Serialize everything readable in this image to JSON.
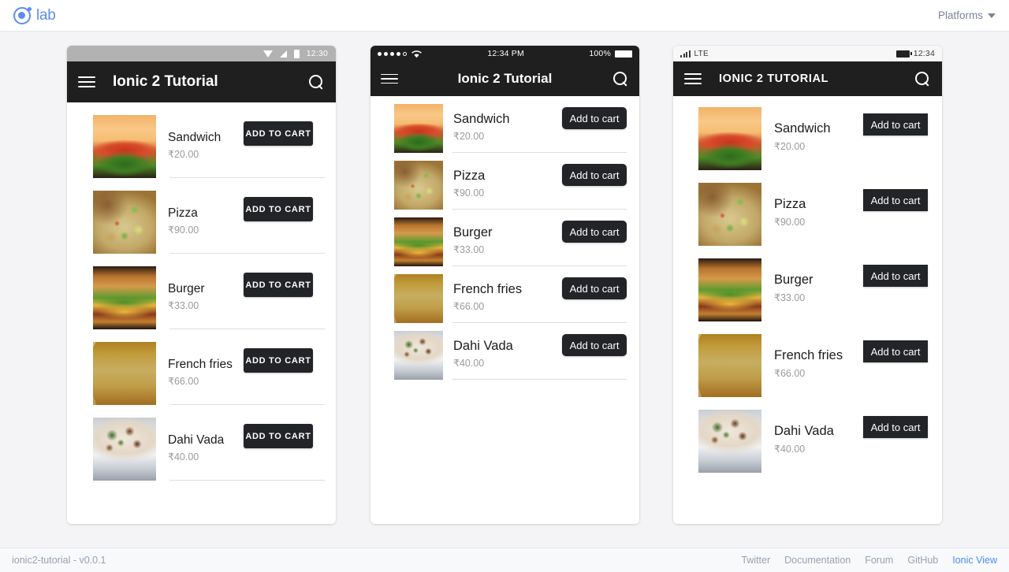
{
  "topbar": {
    "brand_label": "lab",
    "brand_icon": "ionic-lab-logo-icon",
    "platforms_label": "Platforms",
    "caret_icon": "chevron-down-icon",
    "brand_color": "#5b8def"
  },
  "phones": [
    {
      "platform": "android",
      "status": {
        "time": "12:30",
        "wifi_icon": "wifi-icon",
        "signal_icon": "signal-icon",
        "battery_icon": "battery-icon"
      },
      "toolbar": {
        "menu_icon": "hamburger-menu-icon",
        "title": "Ionic 2 Tutorial",
        "search_icon": "search-icon"
      },
      "button_label": "ADD TO CART"
    },
    {
      "platform": "ios",
      "status": {
        "time": "12:34 PM",
        "battery_percent": "100%",
        "wifi_icon": "wifi-icon",
        "signal_icon": "signal-dots-icon",
        "battery_icon": "battery-icon"
      },
      "toolbar": {
        "menu_icon": "hamburger-menu-icon",
        "title": "Ionic 2 Tutorial",
        "search_icon": "search-icon"
      },
      "button_label": "Add to cart"
    },
    {
      "platform": "windows",
      "status": {
        "time": "12:34",
        "network_label": "LTE",
        "signal_icon": "signal-bars-icon",
        "battery_icon": "battery-icon"
      },
      "toolbar": {
        "menu_icon": "hamburger-menu-icon",
        "title": "IONIC 2 TUTORIAL",
        "search_icon": "search-icon"
      },
      "button_label": "Add to cart"
    }
  ],
  "items": [
    {
      "name": "Sandwich",
      "price": "₹20.00",
      "image": "img-sandwich"
    },
    {
      "name": "Pizza",
      "price": "₹90.00",
      "image": "img-pizza"
    },
    {
      "name": "Burger",
      "price": "₹33.00",
      "image": "img-burger"
    },
    {
      "name": "French fries",
      "price": "₹66.00",
      "image": "img-fries"
    },
    {
      "name": "Dahi Vada",
      "price": "₹40.00",
      "image": "img-dahi"
    }
  ],
  "footer": {
    "version": "ionic2-tutorial - v0.0.1",
    "links": [
      {
        "label": "Twitter",
        "accent": false
      },
      {
        "label": "Documentation",
        "accent": false
      },
      {
        "label": "Forum",
        "accent": false
      },
      {
        "label": "GitHub",
        "accent": false
      },
      {
        "label": "Ionic View",
        "accent": true
      }
    ],
    "accent_color": "#4a8bf5"
  }
}
